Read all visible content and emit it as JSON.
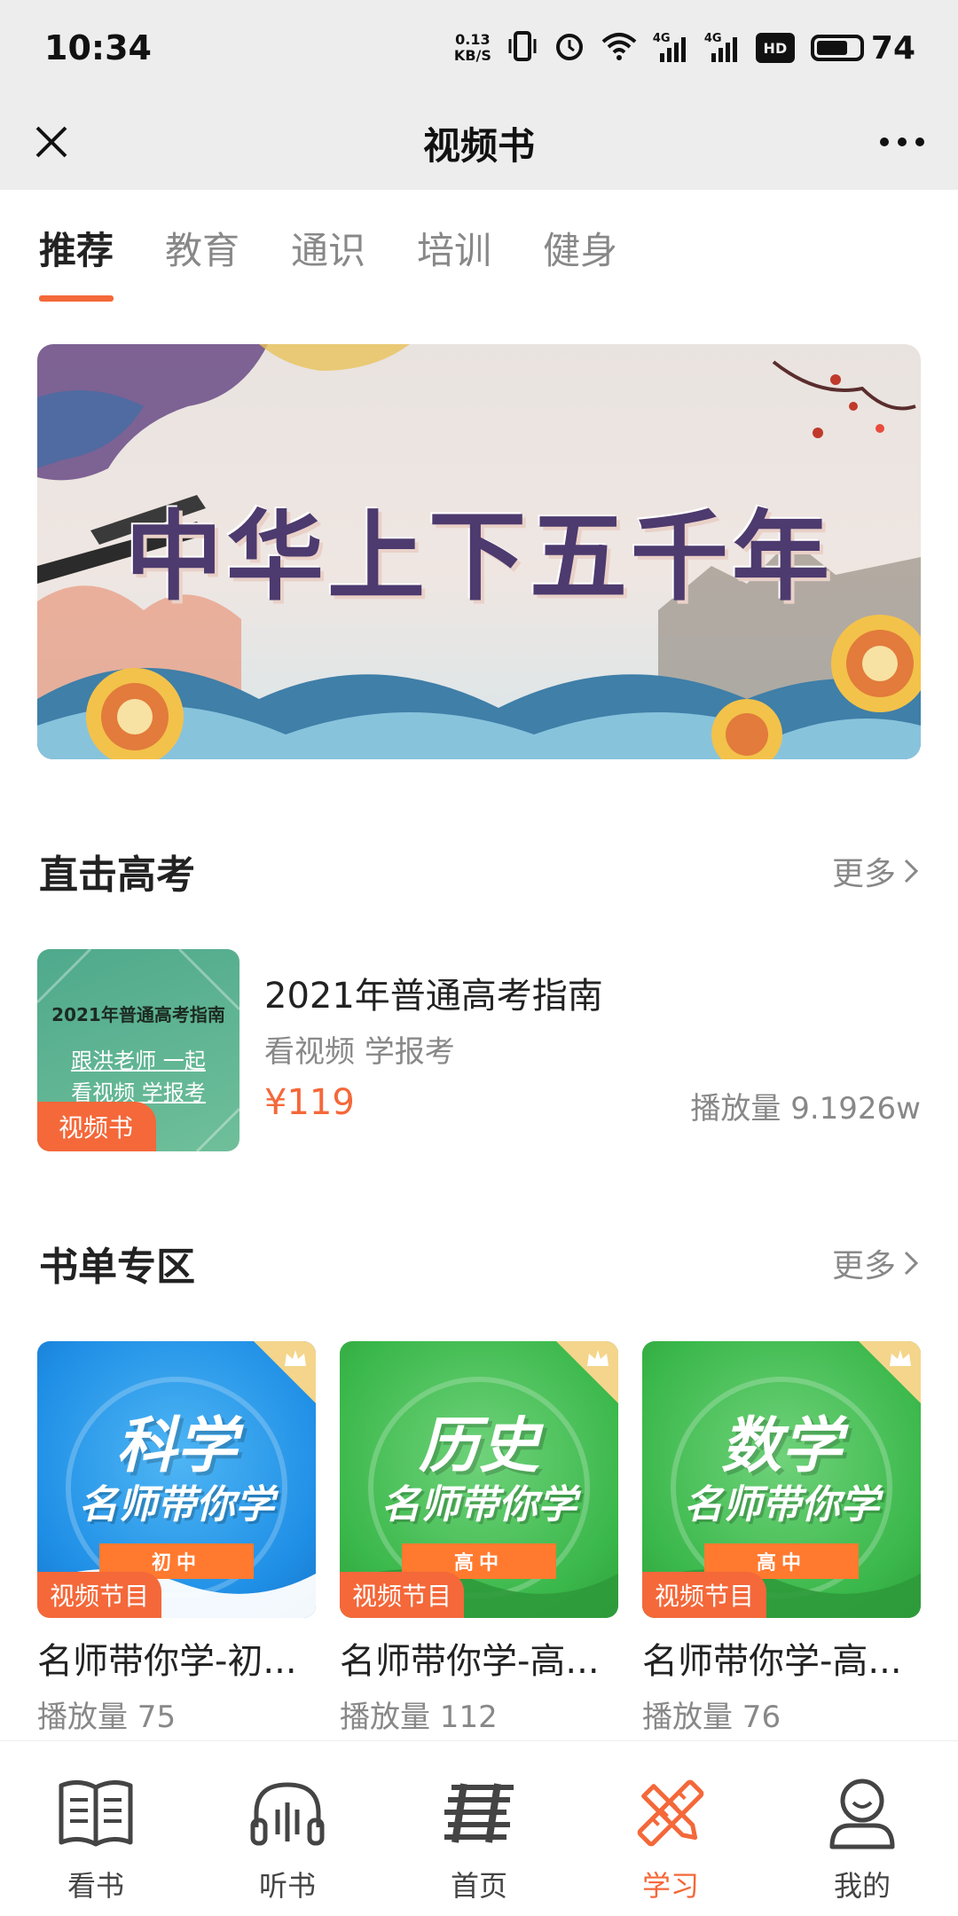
{
  "status": {
    "time": "10:34",
    "net_speed_value": "0.13",
    "net_speed_unit": "KB/S",
    "signal_1_label": "4G",
    "signal_2_label": "4G",
    "hd_label": "HD",
    "battery": "74"
  },
  "header": {
    "title": "视频书",
    "close_icon": "close-icon",
    "more_icon": "more-icon"
  },
  "tabs": [
    {
      "label": "推荐",
      "active": true
    },
    {
      "label": "教育",
      "active": false
    },
    {
      "label": "通识",
      "active": false
    },
    {
      "label": "培训",
      "active": false
    },
    {
      "label": "健身",
      "active": false
    }
  ],
  "banner": {
    "title": "中华上下五千年"
  },
  "gaokao": {
    "section_title": "直击高考",
    "more_label": "更多",
    "item": {
      "cover_heading": "2021年普通高考指南",
      "cover_line1": "跟洪老师 一起",
      "cover_line2": "看视频 学报考",
      "badge": "视频书",
      "title": "2021年普通高考指南",
      "subtitle": "看视频 学报考",
      "price": "¥119",
      "plays": "播放量 9.1926w"
    }
  },
  "booklist": {
    "section_title": "书单专区",
    "more_label": "更多",
    "tagline": "名师带你学",
    "badge": "视频节目",
    "items": [
      {
        "subject": "科学",
        "level": "初中",
        "title": "名师带你学-初...",
        "plays": "播放量 75",
        "color": "#1f8fe6"
      },
      {
        "subject": "历史",
        "level": "高中",
        "title": "名师带你学-高...",
        "plays": "播放量 112",
        "color": "#3bb84b"
      },
      {
        "subject": "数学",
        "level": "高中",
        "title": "名师带你学-高...",
        "plays": "播放量 76",
        "color": "#3bb84b"
      }
    ]
  },
  "bottom_nav": [
    {
      "label": "看书",
      "icon": "book-icon",
      "active": false
    },
    {
      "label": "听书",
      "icon": "headphones-icon",
      "active": false
    },
    {
      "label": "首页",
      "icon": "home-icon",
      "active": false
    },
    {
      "label": "学习",
      "icon": "study-icon",
      "active": true
    },
    {
      "label": "我的",
      "icon": "profile-icon",
      "active": false
    }
  ],
  "colors": {
    "accent": "#f4683a",
    "header_bg": "#ededed",
    "text_secondary": "#888888"
  }
}
